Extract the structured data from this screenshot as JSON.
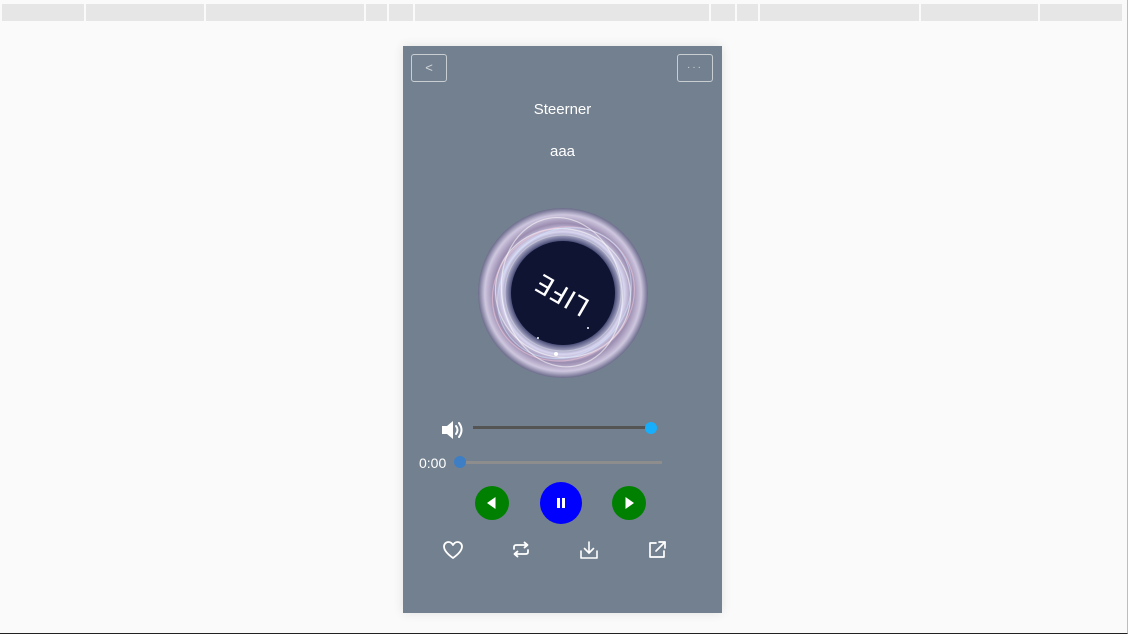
{
  "player": {
    "back_label": "<",
    "more_label": "···",
    "song_title": "Steerner",
    "artist": "aaa",
    "current_time": "0:00",
    "volume_fraction": 1.0,
    "progress_fraction": 0.0,
    "colors": {
      "background": "#73808f",
      "prev_next": "#008000",
      "play_pause": "#0000ff",
      "volume_thumb": "#17aefb",
      "progress_thumb": "#3e7ec5"
    },
    "icons": [
      "volume-icon",
      "prev-icon",
      "pause-icon",
      "next-icon",
      "heart-icon",
      "repeat-icon",
      "download-icon",
      "share-icon"
    ]
  },
  "cover_art": {
    "logo_text": "LIFE"
  }
}
